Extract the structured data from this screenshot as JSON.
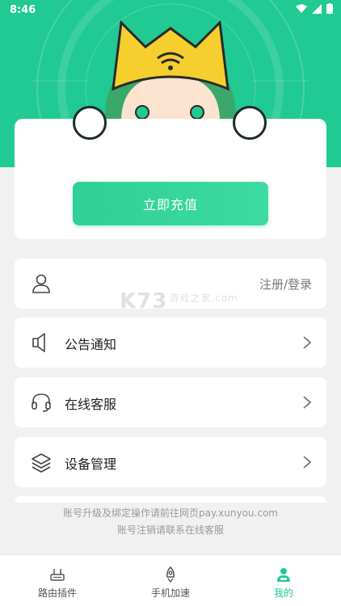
{
  "status_bar": {
    "time": "8:46"
  },
  "recharge": {
    "button_label": "立即充值"
  },
  "account_row": {
    "login_text": "注册/登录"
  },
  "menu": {
    "announcement": "公告通知",
    "online_service": "在线客服",
    "device_management": "设备管理"
  },
  "footer": {
    "line1": "账号升级及绑定操作请前往网页pay.xunyou.com",
    "line2": "账号注销请联系在线客服"
  },
  "watermark": {
    "main": "K73",
    "sub": "游戏之家",
    "domain": ".com"
  },
  "tabs": [
    {
      "label": "路由插件",
      "icon": "router-icon"
    },
    {
      "label": "手机加速",
      "icon": "rocket-icon"
    },
    {
      "label": "我的",
      "icon": "user-icon"
    }
  ],
  "colors": {
    "brand": "#21c993",
    "background": "#f1f1f1"
  }
}
